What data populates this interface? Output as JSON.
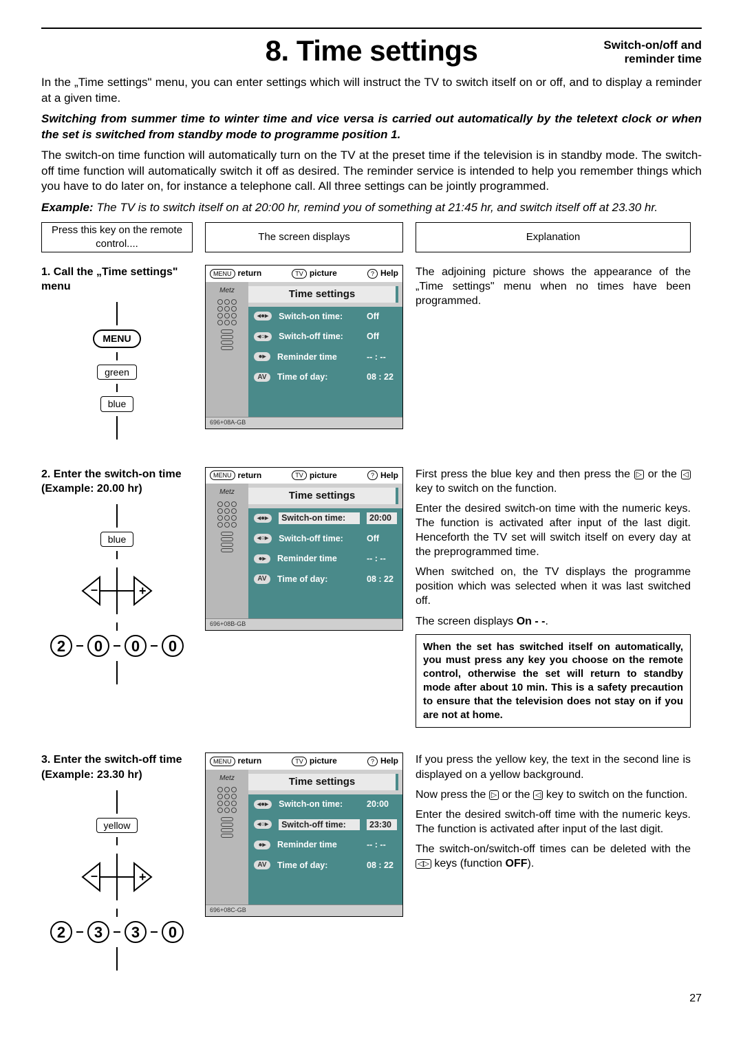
{
  "header": {
    "title": "8. Time settings",
    "subtitle": "Switch-on/off and\nreminder time"
  },
  "intro": {
    "p1": "In the „Time settings\" menu, you can enter settings which will instruct the TV to switch itself on or off, and to display a reminder at a given time.",
    "p2_italic": "Switching from summer time to winter time and vice versa is carried out automatically by the teletext clock or when the set is switched from standby mode to programme position 1.",
    "p3": "The switch-on time function will automatically turn on the TV at the preset time if the television is in standby mode. The switch-off time function will automatically switch it off as desired. The reminder service is intended to help you remember things which you have to do later on, for instance a telephone call. All three settings can be jointly programmed.",
    "example_label": "Example:",
    "example_text": " The TV is to switch itself on at 20:00 hr, remind you of something at 21:45 hr, and switch itself off at 23.30 hr."
  },
  "columns": {
    "remote": "Press this key on the remote control....",
    "screen": "The screen displays",
    "explain": "Explanation"
  },
  "screen_common": {
    "return": "return",
    "picture": "picture",
    "help": "Help",
    "title": "Time settings",
    "rows": {
      "on": "Switch-on time:",
      "off": "Switch-off time:",
      "rem": "Reminder time",
      "tod": "Time of day:"
    },
    "pill_menu": "MENU",
    "pill_tv": "TV",
    "pill_help": "?",
    "pill_av": "AV"
  },
  "steps": {
    "s1": {
      "title": "1. Call the „Time settings\" menu",
      "keys": {
        "menu": "MENU",
        "green": "green",
        "blue": "blue"
      },
      "screen": {
        "on": "Off",
        "off": "Off",
        "rem": "-- : --",
        "tod": "08 : 22",
        "footer": "696+08A-GB",
        "selected": ""
      },
      "explain": "The adjoining picture shows the appearance of the „Time settings\" menu when no times have been programmed."
    },
    "s2": {
      "title": "2. Enter the switch-on time (Example: 20.00 hr)",
      "keys": {
        "blue": "blue"
      },
      "digits": [
        "2",
        "0",
        "0",
        "0"
      ],
      "screen": {
        "on": "20:00",
        "off": "Off",
        "rem": "-- : --",
        "tod": "08 : 22",
        "footer": "696+08B-GB",
        "selected": "on"
      },
      "exp1": "First press the blue key and then press the ",
      "exp1b": " or the ",
      "exp1c": " key to switch on the function.",
      "exp2": "Enter the desired switch-on time with the numeric keys. The function is activated after input of the last digit. Henceforth the TV set will switch itself on every day at the preprogrammed time.",
      "exp3": "When switched on, the TV displays the programme position which was selected when it was last switched off.",
      "exp4a": "The screen displays ",
      "exp4b": "On - -",
      "exp4c": ".",
      "note": "When the set has switched itself on automatically, you must press any key you choose on the remote control, otherwise the set will return to standby mode after about 10 min. This is a safety precaution to ensure that the television does not stay on if you are not at home."
    },
    "s3": {
      "title": "3. Enter the switch-off time (Example: 23.30 hr)",
      "keys": {
        "yellow": "yellow"
      },
      "digits": [
        "2",
        "3",
        "3",
        "0"
      ],
      "screen": {
        "on": "20:00",
        "off": "23:30",
        "rem": "-- : --",
        "tod": "08 : 22",
        "footer": "696+08C-GB",
        "selected": "off"
      },
      "exp1": "If you press the yellow key, the text in the second line is displayed on a yellow background.",
      "exp2a": "Now press the ",
      "exp2b": " or the ",
      "exp2c": " key to switch on the function.",
      "exp3": "Enter the desired switch-off time with the numeric keys. The function is activated after input of the last digit.",
      "exp4a": "The switch-on/switch-off times can be deleted with the ",
      "exp4b": " keys (function ",
      "exp4c": "OFF",
      "exp4d": ")."
    }
  },
  "page_number": "27",
  "glyphs": {
    "right": "▷",
    "left": "◁",
    "leftright": "◁▷"
  }
}
